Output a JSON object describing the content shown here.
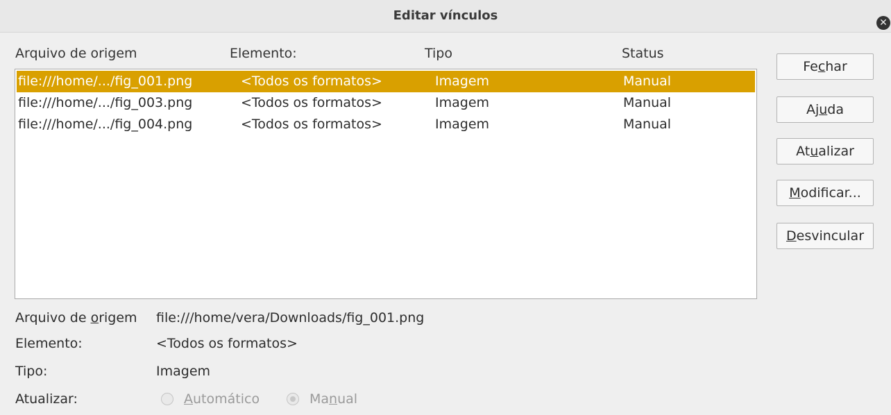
{
  "window": {
    "title": "Editar vínculos",
    "close_icon": "close-icon"
  },
  "columns": [
    "Arquivo de origem",
    "Elemento:",
    "Tipo",
    "Status"
  ],
  "links": [
    {
      "source": "file:///home/.../fig_001.png",
      "element": "<Todos os formatos>",
      "type": "Imagem",
      "status": "Manual",
      "selected": true
    },
    {
      "source": "file:///home/.../fig_003.png",
      "element": "<Todos os formatos>",
      "type": "Imagem",
      "status": "Manual",
      "selected": false
    },
    {
      "source": "file:///home/.../fig_004.png",
      "element": "<Todos os formatos>",
      "type": "Imagem",
      "status": "Manual",
      "selected": false
    }
  ],
  "buttons": {
    "close": {
      "pre": "Fe",
      "mn": "c",
      "post": "har"
    },
    "help": {
      "pre": "Aj",
      "mn": "u",
      "post": "da"
    },
    "update": {
      "pre": "At",
      "mn": "u",
      "post": "alizar"
    },
    "modify": {
      "pre": "",
      "mn": "M",
      "post": "odificar..."
    },
    "unlink": {
      "pre": "",
      "mn": "D",
      "post": "esvincular"
    }
  },
  "details": {
    "source_label": {
      "pre": "Arquivo de ",
      "mn": "o",
      "post": "rigem"
    },
    "source_value": "file:///home/vera/Downloads/fig_001.png",
    "element_label": "Elemento:",
    "element_value": "<Todos os formatos>",
    "type_label": "Tipo:",
    "type_value": "Imagem",
    "update_label": "Atualizar:",
    "auto": {
      "pre": "",
      "mn": "A",
      "post": "utomático",
      "checked": false
    },
    "manual": {
      "pre": "Ma",
      "mn": "n",
      "post": "ual",
      "checked": true
    }
  },
  "colors": {
    "selection": "#d9a000",
    "disabled_text": "#9a9a9a"
  }
}
